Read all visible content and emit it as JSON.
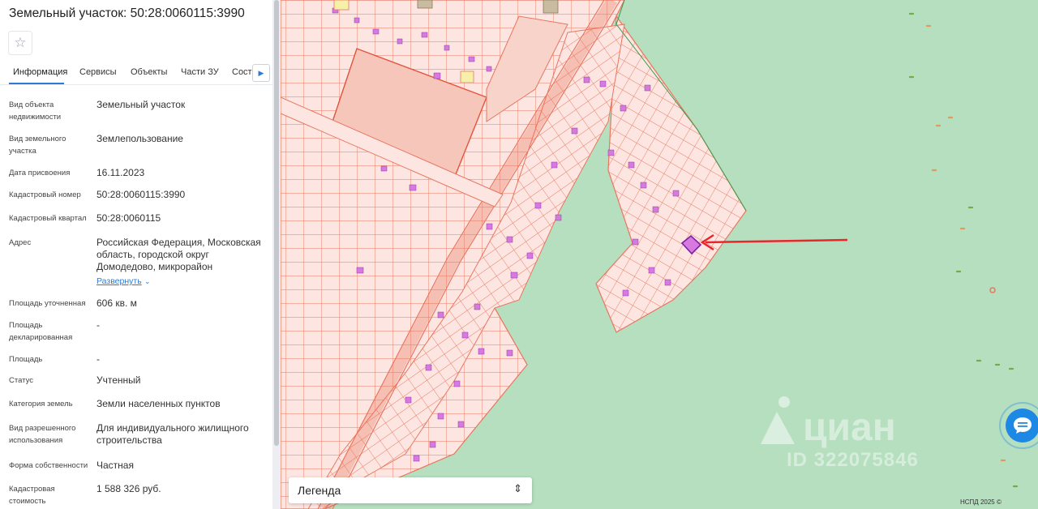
{
  "panel": {
    "title": "Земельный участок: 50:28:0060115:3990",
    "tabs": [
      "Информация",
      "Сервисы",
      "Объекты",
      "Части ЗУ",
      "Состав"
    ],
    "fields": [
      {
        "label": "Вид объекта недвижимости",
        "value": "Земельный участок"
      },
      {
        "label": "Вид земельного участка",
        "value": "Землепользование"
      },
      {
        "label": "Дата присвоения",
        "value": "16.11.2023"
      },
      {
        "label": "Кадастровый номер",
        "value": "50:28:0060115:3990"
      },
      {
        "label": "Кадастровый квартал",
        "value": "50:28:0060115"
      },
      {
        "label": "Адрес",
        "value": "Российская Федерация, Московская область, городской округ Домодедово, микрорайон"
      },
      {
        "label": "Площадь уточненная",
        "value": "606 кв. м"
      },
      {
        "label": "Площадь декларированная",
        "value": "-"
      },
      {
        "label": "Площадь",
        "value": "-"
      },
      {
        "label": "Статус",
        "value": "Учтенный"
      },
      {
        "label": "Категория земель",
        "value": "Земли населенных пунктов"
      },
      {
        "label": "Вид разрешенного использования",
        "value": "Для индивидуального жилищного строительства"
      },
      {
        "label": "Форма собственности",
        "value": "Частная"
      },
      {
        "label": "Кадастровая стоимость",
        "value": "1 588 326 руб."
      }
    ],
    "expand_label": "Развернуть"
  },
  "map": {
    "legend_title": "Легенда",
    "copyright": "НСПД 2025 ©",
    "watermark_text": "циан",
    "watermark_id": "ID 322075846",
    "colors": {
      "forest": "#b5dfbf",
      "parcel_fill": "#fde6e1",
      "parcel_line": "#e8765f",
      "building": "#d77ae0",
      "arrow": "#e8262c"
    }
  }
}
